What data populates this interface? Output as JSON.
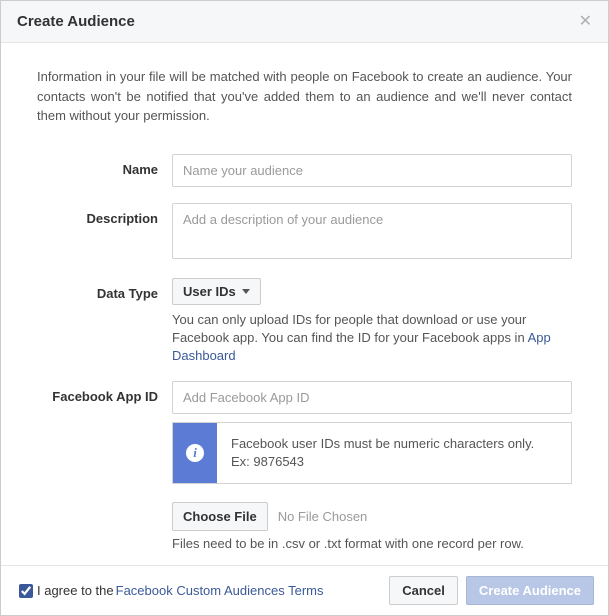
{
  "header": {
    "title": "Create Audience"
  },
  "intro": "Information in your file will be matched with people on Facebook to create an audience. Your contacts won't be notified that you've added them to an audience and we'll never contact them without your permission.",
  "fields": {
    "name": {
      "label": "Name",
      "placeholder": "Name your audience"
    },
    "description": {
      "label": "Description",
      "placeholder": "Add a description of your audience"
    },
    "dataType": {
      "label": "Data Type",
      "selected": "User IDs",
      "help_prefix": "You can only upload IDs for people that download or use your Facebook app. You can find the ID for your Facebook apps in ",
      "help_link": "App Dashboard"
    },
    "appId": {
      "label": "Facebook App ID",
      "placeholder": "Add Facebook App ID",
      "info_line1": "Facebook user IDs must be numeric characters only.",
      "info_line2": "Ex: 9876543"
    },
    "file": {
      "button": "Choose File",
      "status": "No File Chosen",
      "help": "Files need to be in .csv or .txt format with one record per row."
    }
  },
  "footer": {
    "agree_prefix": "I agree to the ",
    "agree_link": "Facebook Custom Audiences Terms",
    "cancel": "Cancel",
    "submit": "Create Audience"
  }
}
